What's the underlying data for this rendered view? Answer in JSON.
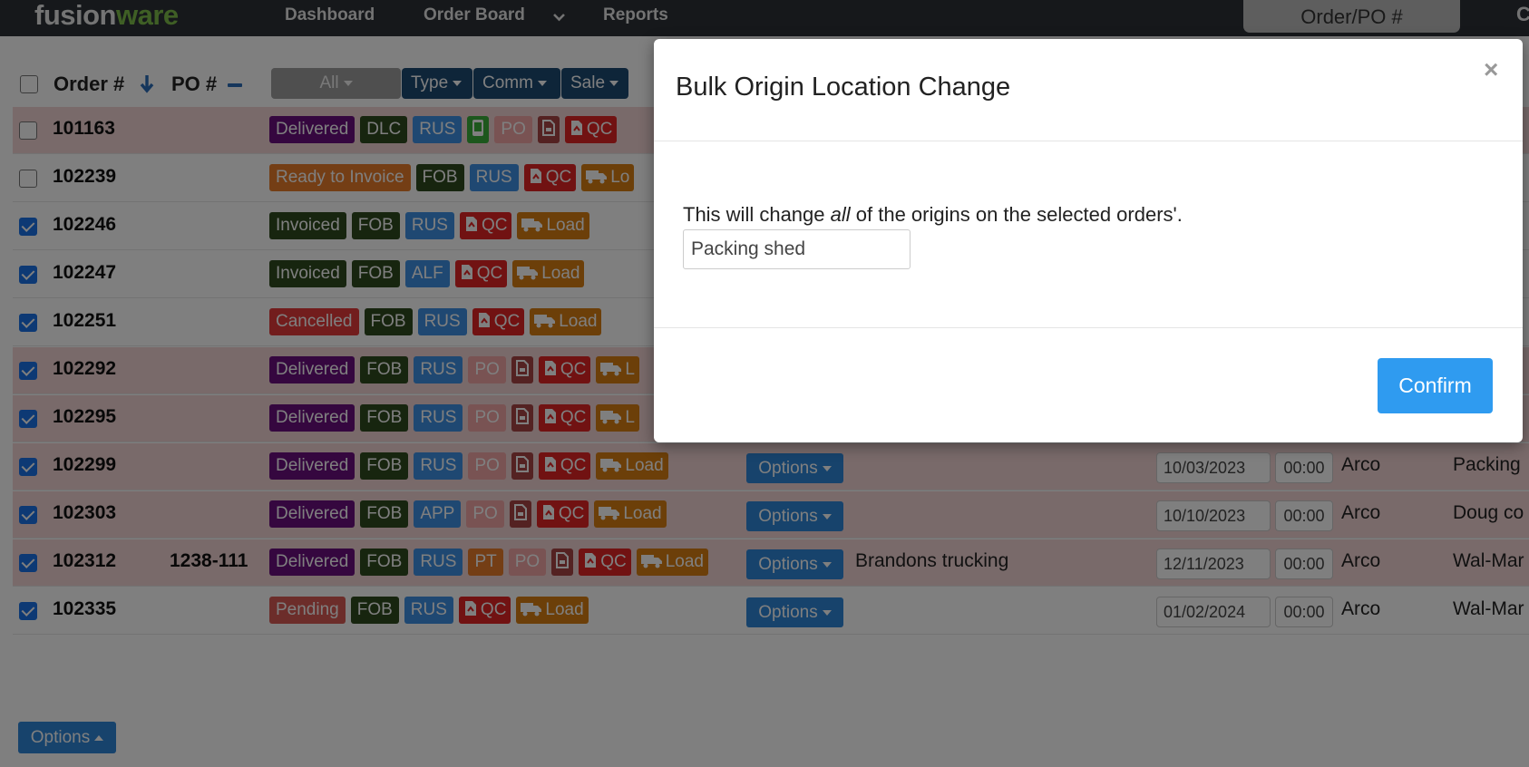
{
  "navbar": {
    "logo_part1": "fusion",
    "logo_part2": "ware",
    "links": [
      "Dashboard",
      "Order Board",
      "Reports"
    ],
    "search_placeholder": "Order/PO #",
    "edge_text": "C"
  },
  "table": {
    "headers": {
      "order": "Order #",
      "po": "PO #"
    },
    "filters": [
      "All",
      "Type",
      "Comm",
      "Sale"
    ],
    "rows": [
      {
        "order": "101163",
        "po": "",
        "checked": false,
        "color": "pink",
        "badges": [
          [
            "Delivered",
            "purple"
          ],
          [
            "DLC",
            "olive"
          ],
          [
            "RUS",
            "blue"
          ],
          [
            "phone-icon",
            "green"
          ],
          [
            "PO",
            "pinkb"
          ],
          [
            "document-icon",
            "maroon"
          ],
          [
            "QC",
            "red"
          ]
        ]
      },
      {
        "order": "102239",
        "po": "",
        "checked": false,
        "color": "white",
        "badges": [
          [
            "Ready to Invoice",
            "orange"
          ],
          [
            "FOB",
            "olive"
          ],
          [
            "RUS",
            "blue"
          ],
          [
            "QC",
            "red"
          ],
          [
            "Lo",
            "amber"
          ]
        ]
      },
      {
        "order": "102246",
        "po": "",
        "checked": true,
        "color": "white",
        "badges": [
          [
            "Invoiced",
            "olive"
          ],
          [
            "FOB",
            "olive"
          ],
          [
            "RUS",
            "blue"
          ],
          [
            "QC",
            "red"
          ],
          [
            "Load",
            "amber"
          ]
        ]
      },
      {
        "order": "102247",
        "po": "",
        "checked": true,
        "color": "white",
        "badges": [
          [
            "Invoiced",
            "olive"
          ],
          [
            "FOB",
            "olive"
          ],
          [
            "ALF",
            "blue"
          ],
          [
            "QC",
            "red"
          ],
          [
            "Load",
            "amber"
          ]
        ]
      },
      {
        "order": "102251",
        "po": "",
        "checked": true,
        "color": "white",
        "badges": [
          [
            "Cancelled",
            "cancel"
          ],
          [
            "FOB",
            "olive"
          ],
          [
            "RUS",
            "blue"
          ],
          [
            "QC",
            "red"
          ],
          [
            "Load",
            "amber"
          ]
        ]
      },
      {
        "order": "102292",
        "po": "",
        "checked": true,
        "color": "pink",
        "badges": [
          [
            "Delivered",
            "purple"
          ],
          [
            "FOB",
            "olive"
          ],
          [
            "RUS",
            "blue"
          ],
          [
            "PO",
            "pinkb"
          ],
          [
            "document-icon",
            "maroon"
          ],
          [
            "QC",
            "red"
          ],
          [
            "L",
            "amber"
          ]
        ]
      },
      {
        "order": "102295",
        "po": "",
        "checked": true,
        "color": "pink",
        "badges": [
          [
            "Delivered",
            "purple"
          ],
          [
            "FOB",
            "olive"
          ],
          [
            "RUS",
            "blue"
          ],
          [
            "PO",
            "pinkb"
          ],
          [
            "document-icon",
            "maroon"
          ],
          [
            "QC",
            "red"
          ],
          [
            "L",
            "amber"
          ]
        ]
      },
      {
        "order": "102299",
        "po": "",
        "checked": true,
        "color": "pink",
        "badges": [
          [
            "Delivered",
            "purple"
          ],
          [
            "FOB",
            "olive"
          ],
          [
            "RUS",
            "blue"
          ],
          [
            "PO",
            "pinkb"
          ],
          [
            "document-icon",
            "maroon"
          ],
          [
            "QC",
            "red"
          ],
          [
            "Load",
            "amber"
          ]
        ],
        "options": "Options",
        "carrier": "",
        "date": "10/03/2023",
        "time": "00:00",
        "loc": "Arco",
        "dest": "Packing"
      },
      {
        "order": "102303",
        "po": "",
        "checked": true,
        "color": "pink",
        "badges": [
          [
            "Delivered",
            "purple"
          ],
          [
            "FOB",
            "olive"
          ],
          [
            "APP",
            "blue"
          ],
          [
            "PO",
            "pinkb"
          ],
          [
            "document-icon",
            "maroon"
          ],
          [
            "QC",
            "red"
          ],
          [
            "Load",
            "amber"
          ]
        ],
        "options": "Options",
        "carrier": "",
        "date": "10/10/2023",
        "time": "00:00",
        "loc": "Arco",
        "dest": "Doug co"
      },
      {
        "order": "102312",
        "po": "1238-111",
        "checked": true,
        "color": "pink",
        "badges": [
          [
            "Delivered",
            "purple"
          ],
          [
            "FOB",
            "olive"
          ],
          [
            "RUS",
            "blue"
          ],
          [
            "PT",
            "orange"
          ],
          [
            "PO",
            "pinkb"
          ],
          [
            "document-icon",
            "maroon"
          ],
          [
            "QC",
            "red"
          ],
          [
            "Load",
            "amber"
          ]
        ],
        "options": "Options",
        "carrier": "Brandons trucking",
        "date": "12/11/2023",
        "time": "00:00",
        "loc": "Arco",
        "dest": "Wal-Mar"
      },
      {
        "order": "102335",
        "po": "",
        "checked": true,
        "color": "white",
        "badges": [
          [
            "Pending",
            "pending"
          ],
          [
            "FOB",
            "olive"
          ],
          [
            "RUS",
            "blue"
          ],
          [
            "QC",
            "red"
          ],
          [
            "Load",
            "amber"
          ]
        ],
        "options": "Options",
        "carrier": "",
        "date": "01/02/2024",
        "time": "00:00",
        "loc": "Arco",
        "dest": "Wal-Mar"
      }
    ]
  },
  "footer": {
    "options_label": "Options"
  },
  "modal": {
    "title": "Bulk Origin Location Change",
    "close": "×",
    "text_before": "This will change ",
    "text_em": "all",
    "text_after": " of the origins on the selected orders'.",
    "input_value": "Packing shed",
    "confirm_label": "Confirm"
  }
}
